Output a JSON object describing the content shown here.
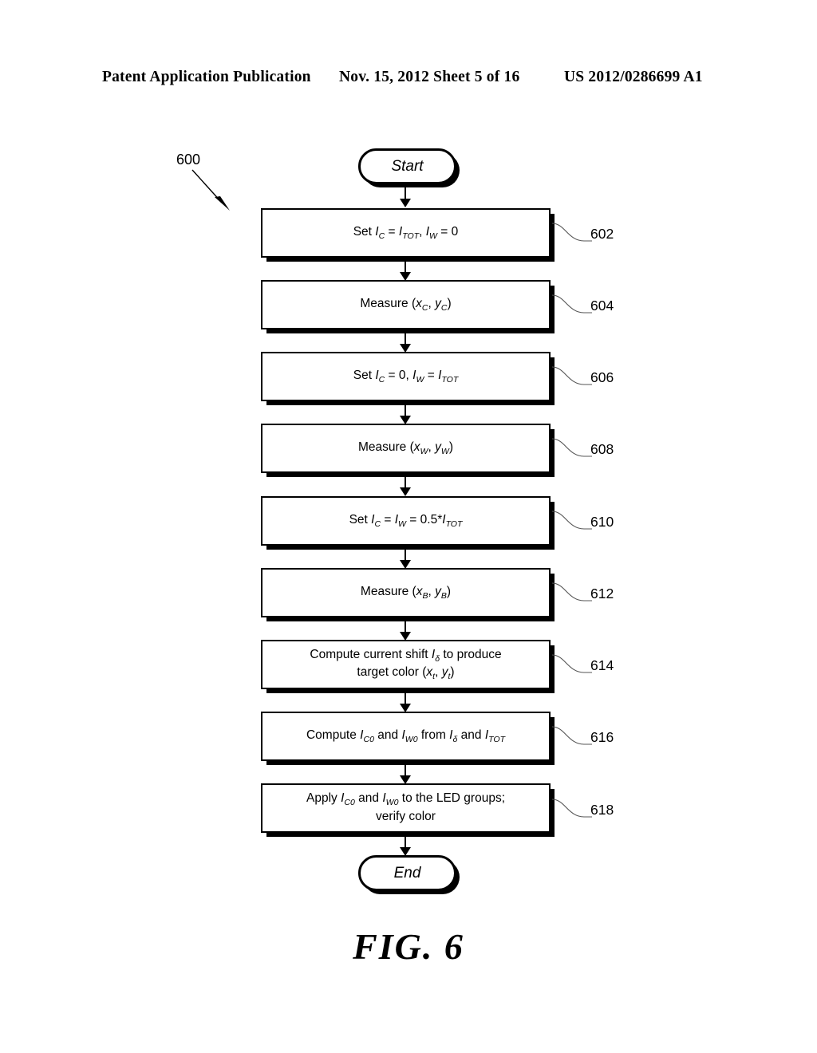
{
  "header": {
    "left": "Patent Application Publication",
    "middle": "Nov. 15, 2012  Sheet 5 of 16",
    "right": "US 2012/0286699 A1"
  },
  "figure": {
    "caption": "FIG. 6",
    "flow_id": "600",
    "start_label": "Start",
    "end_label": "End"
  },
  "flow": {
    "steps": [
      {
        "ref": "602",
        "text": "Set IC = ITOT, IW = 0"
      },
      {
        "ref": "604",
        "text": "Measure (xC, yC)"
      },
      {
        "ref": "606",
        "text": "Set IC = 0, IW = ITOT"
      },
      {
        "ref": "608",
        "text": "Measure (xW, yW)"
      },
      {
        "ref": "610",
        "text": "Set IC = IW = 0.5*ITOT"
      },
      {
        "ref": "612",
        "text": "Measure (xB, yB)"
      },
      {
        "ref": "614",
        "text": "Compute current shift Iδ to produce target color (xt, yt)"
      },
      {
        "ref": "616",
        "text": "Compute IC0 and IW0 from Iδ and ITOT"
      },
      {
        "ref": "618",
        "text": "Apply IC0 and IW0 to the LED groups; verify color"
      }
    ],
    "ref_labels": [
      "602",
      "604",
      "606",
      "608",
      "610",
      "612",
      "614",
      "616",
      "618"
    ]
  }
}
